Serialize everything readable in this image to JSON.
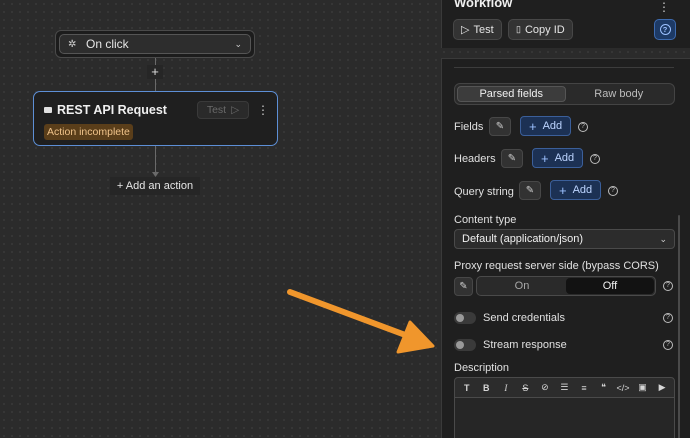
{
  "canvas": {
    "trigger": {
      "label": "On click",
      "icon": "pointer-click-icon"
    },
    "add_step_symbol": "+",
    "action_node": {
      "title": "REST API Request",
      "test_label": "Test",
      "status_badge": "Action incomplete"
    },
    "add_action_label": "+ Add an action"
  },
  "panel_header": {
    "title": "Workflow",
    "test_label": "Test",
    "copy_id_label": "Copy ID"
  },
  "panel": {
    "tabs": [
      "Parsed fields",
      "Raw body"
    ],
    "active_tab": "Parsed fields",
    "fields_label": "Fields",
    "headers_label": "Headers",
    "query_string_label": "Query string",
    "add_label": "Add",
    "content_type_label": "Content type",
    "content_type_value": "Default (application/json)",
    "proxy_label": "Proxy request server side (bypass CORS)",
    "proxy_options": [
      "On",
      "Off"
    ],
    "proxy_selected": "Off",
    "send_credentials_label": "Send credentials",
    "send_credentials_enabled": false,
    "stream_response_label": "Stream response",
    "stream_response_enabled": false,
    "description_label": "Description",
    "editor_tools": [
      "T",
      "B",
      "I",
      "S",
      "link",
      "bullet-list",
      "ordered-list",
      "quote",
      "code",
      "image",
      "video"
    ]
  },
  "colors": {
    "accent": "#5d8fd6",
    "arrow": "#f0962c",
    "badge_bg": "#5a3e1a",
    "badge_text": "#f0c38a"
  }
}
